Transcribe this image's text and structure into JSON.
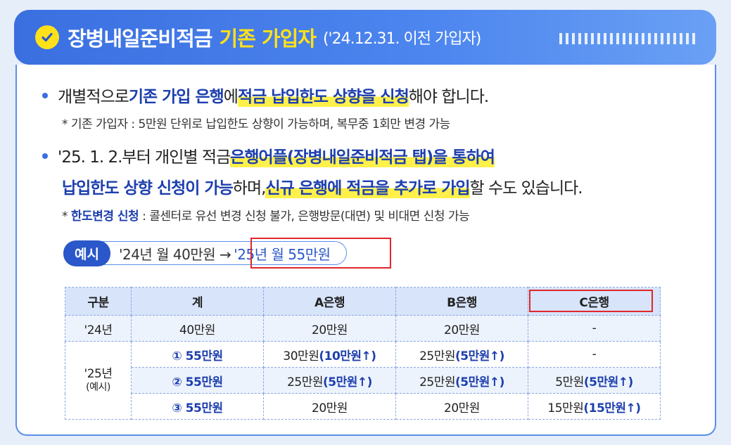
{
  "header": {
    "title": "장병내일준비적금",
    "highlight": "기존 가입자",
    "subtitle": "('24.12.31. 이전 가입자)",
    "accent_color": "#3a6fe0",
    "highlight_color": "#ffe11a",
    "icon": "check-circle-icon"
  },
  "bullet1": {
    "p1": "개별적으로 ",
    "p2": "기존 가입 은행",
    "p3": "에 ",
    "p4": "적금 납입한도 상향을 신청",
    "p5": "해야 합니다."
  },
  "note1": "* 기존 가입자 : 5만원 단위로 납입한도 상향이 가능하며, 복무중 1회만 변경 가능",
  "bullet2": {
    "p1": "'25. 1. 2.부터 개인별 적금 ",
    "p2": "은행어플(장병내일준비적금 탭)을 통하여",
    "p3": "납입한도 상향 신청이 가능",
    "p4": "하며, ",
    "p5": "신규 은행에 적금을 추가로 가입",
    "p6": "할 수도 있습니다."
  },
  "note2": {
    "prefix": "* ",
    "strong": "한도변경 신청",
    "rest": " : 콜센터로 유선 변경 신청 불가, 은행방문(대면) 및 비대면 신청 가능"
  },
  "example": {
    "label": "예시",
    "before": "'24년 월 40만원 →",
    "after": "'25년 월 55만원"
  },
  "table": {
    "headers": [
      "구분",
      "계",
      "A은행",
      "B은행",
      "C은행"
    ],
    "row24": {
      "year": "'24년",
      "total": "40만원",
      "a": "20만원",
      "b": "20만원",
      "c": "-"
    },
    "year25": "'25년",
    "year25_note": "(예시)",
    "rows25": [
      {
        "total": "① 55만원",
        "a": "30만원",
        "a_up": "(10만원↑)",
        "b": "25만원",
        "b_up": "(5만원↑)",
        "c": "-",
        "c_up": ""
      },
      {
        "total": "② 55만원",
        "a": "25만원",
        "a_up": "(5만원↑)",
        "b": "25만원",
        "b_up": "(5만원↑)",
        "c": "5만원",
        "c_up": "(5만원↑)"
      },
      {
        "total": "③ 55만원",
        "a": "20만원",
        "a_up": "",
        "b": "20만원",
        "b_up": "",
        "c": "15만원",
        "c_up": "(15만원↑)"
      }
    ]
  }
}
